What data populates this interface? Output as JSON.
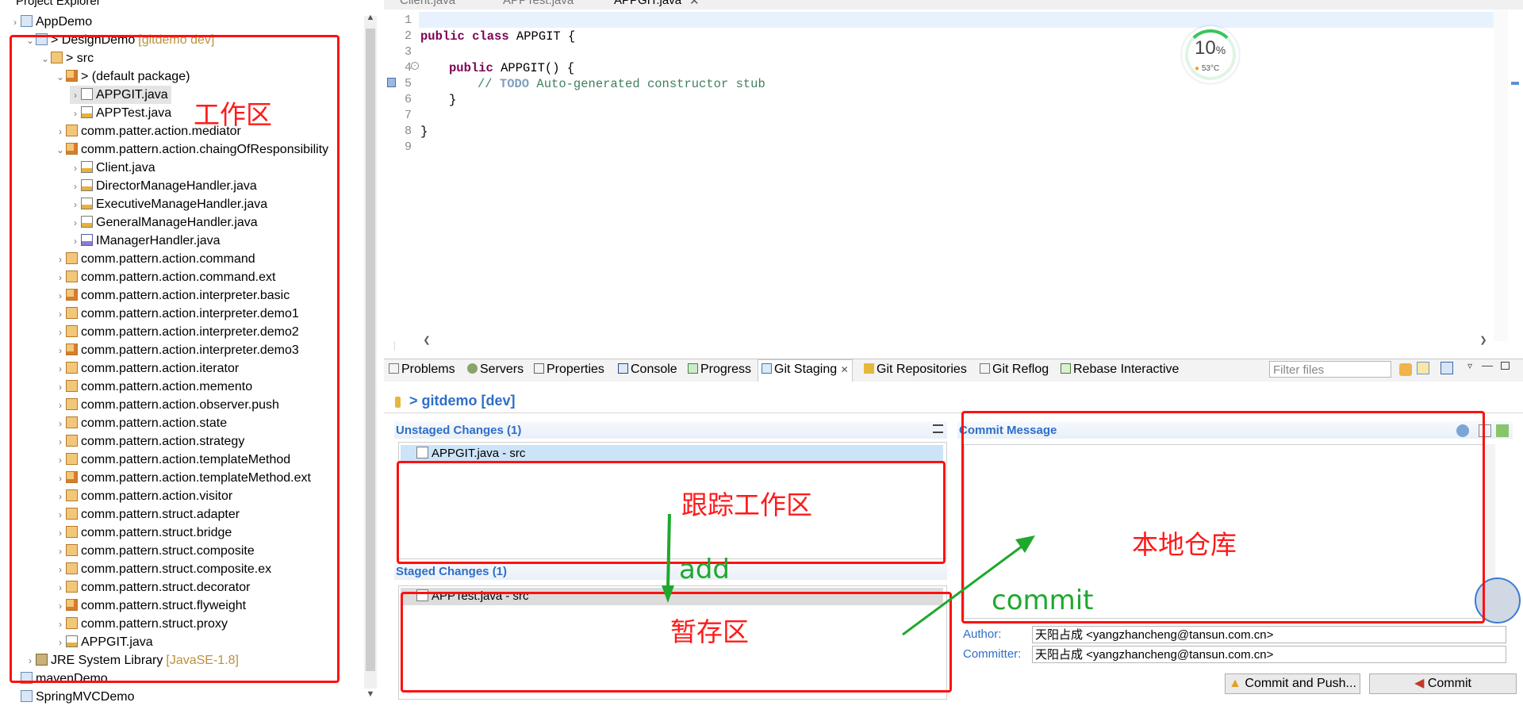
{
  "explorer": {
    "title": "Project Explorer",
    "rows": [
      {
        "label": "AppDemo",
        "deco": ""
      },
      {
        "label": "> DesignDemo",
        "deco": "[gitdemo dev]"
      },
      {
        "label": "> src",
        "deco": ""
      },
      {
        "label": "> (default package)",
        "deco": ""
      },
      {
        "label": "APPGIT.java",
        "deco": ""
      },
      {
        "label": "APPTest.java",
        "deco": ""
      },
      {
        "label": "comm.patter.action.mediator",
        "deco": ""
      },
      {
        "label": "comm.pattern.action.chaingOfResponsibility",
        "deco": ""
      },
      {
        "label": "Client.java",
        "deco": ""
      },
      {
        "label": "DirectorManageHandler.java",
        "deco": ""
      },
      {
        "label": "ExecutiveManageHandler.java",
        "deco": ""
      },
      {
        "label": "GeneralManageHandler.java",
        "deco": ""
      },
      {
        "label": "IManagerHandler.java",
        "deco": ""
      },
      {
        "label": "comm.pattern.action.command",
        "deco": ""
      },
      {
        "label": "comm.pattern.action.command.ext",
        "deco": ""
      },
      {
        "label": "comm.pattern.action.interpreter.basic",
        "deco": ""
      },
      {
        "label": "comm.pattern.action.interpreter.demo1",
        "deco": ""
      },
      {
        "label": "comm.pattern.action.interpreter.demo2",
        "deco": ""
      },
      {
        "label": "comm.pattern.action.interpreter.demo3",
        "deco": ""
      },
      {
        "label": "comm.pattern.action.iterator",
        "deco": ""
      },
      {
        "label": "comm.pattern.action.memento",
        "deco": ""
      },
      {
        "label": "comm.pattern.action.observer.push",
        "deco": ""
      },
      {
        "label": "comm.pattern.action.state",
        "deco": ""
      },
      {
        "label": "comm.pattern.action.strategy",
        "deco": ""
      },
      {
        "label": "comm.pattern.action.templateMethod",
        "deco": ""
      },
      {
        "label": "comm.pattern.action.templateMethod.ext",
        "deco": ""
      },
      {
        "label": "comm.pattern.action.visitor",
        "deco": ""
      },
      {
        "label": "comm.pattern.struct.adapter",
        "deco": ""
      },
      {
        "label": "comm.pattern.struct.bridge",
        "deco": ""
      },
      {
        "label": "comm.pattern.struct.composite",
        "deco": ""
      },
      {
        "label": "comm.pattern.struct.composite.ex",
        "deco": ""
      },
      {
        "label": "comm.pattern.struct.decorator",
        "deco": ""
      },
      {
        "label": "comm.pattern.struct.flyweight",
        "deco": ""
      },
      {
        "label": "comm.pattern.struct.proxy",
        "deco": ""
      },
      {
        "label": "APPGIT.java",
        "deco": ""
      },
      {
        "label": "JRE System Library",
        "deco": "[JavaSE-1.8]"
      },
      {
        "label": "mavenDemo",
        "deco": ""
      },
      {
        "label": "SpringMVCDemo",
        "deco": ""
      }
    ]
  },
  "annotations": {
    "workspace": "工作区",
    "tracked": "跟踪工作区",
    "local_repo": "本地仓库",
    "staging": "暂存区",
    "add": "add",
    "commit": "commit"
  },
  "editor": {
    "tabs": [
      "Client.java",
      "APPTest.java",
      "APPGIT.java"
    ],
    "line_numbers": [
      "1",
      "2",
      "3",
      "4",
      "5",
      "6",
      "7",
      "8",
      "9"
    ],
    "code": {
      "l2_kw": "public class",
      "l2_rest": " APPGIT {",
      "l4_kw": "public",
      "l4_rest": " APPGIT() {",
      "l5_c1": "// ",
      "l5_todo": "TODO",
      "l5_c2": " Auto-generated constructor stub",
      "l6": "}",
      "l8": "}"
    }
  },
  "perf_widget": {
    "percent": "10",
    "unit": "%",
    "temp": "53°C"
  },
  "views": {
    "tabs": [
      "Problems",
      "Servers",
      "Properties",
      "Console",
      "Progress",
      "Git Staging",
      "Git Repositories",
      "Git Reflog",
      "Rebase Interactive"
    ],
    "filter_placeholder": "Filter files"
  },
  "staging": {
    "repo": "> gitdemo [dev]",
    "unstaged_title": "Unstaged Changes (1)",
    "unstaged_files": [
      "APPGIT.java - src"
    ],
    "staged_title": "Staged Changes (1)",
    "staged_files": [
      "APPTest.java - src"
    ],
    "commit_message_title": "Commit Message",
    "commit_message": "",
    "author_label": "Author:",
    "author": "天阳占成 <yangzhancheng@tansun.com.cn>",
    "committer_label": "Committer:",
    "committer": "天阳占成 <yangzhancheng@tansun.com.cn>",
    "commit_push_button": "Commit and Push...",
    "commit_button": "Commit"
  },
  "colors": {
    "accent": "#2f6ec7",
    "annotation_red": "#ff1010",
    "annotation_green": "#1fa82e"
  }
}
